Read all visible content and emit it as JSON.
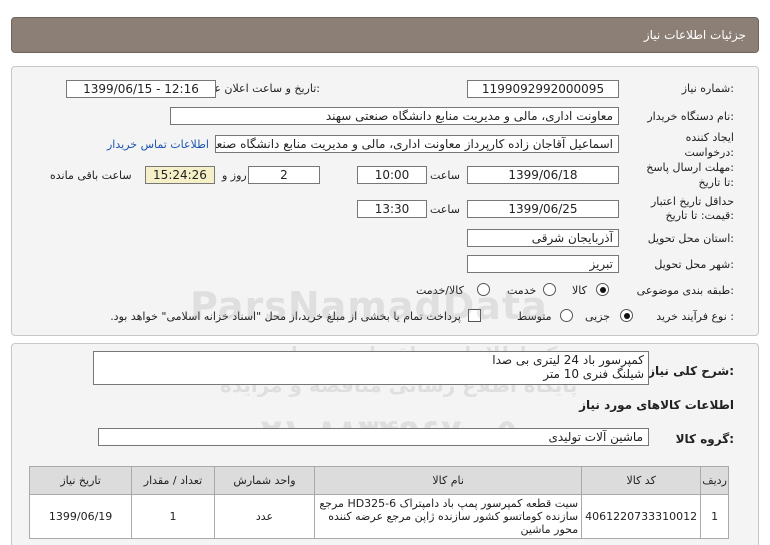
{
  "header": {
    "title": "جزئیات اطلاعات نیاز"
  },
  "form": {
    "need_number_label": "شماره نیاز:",
    "need_number": "1199092992000095",
    "announce_label": "تاریخ و ساعت اعلان عمومی:",
    "announce_value": "1399/06/15 - 12:16",
    "buyer_label": "نام دستگاه خریدار:",
    "buyer_value": "معاونت اداری، مالی و مدیریت منابع دانشگاه صنعتی سهند",
    "creator_label_1": "ایجاد کننده",
    "creator_label_2": "درخواست:",
    "creator_value": "اسماعیل آقاجان زاده کارپرداز معاونت اداری، مالی و مدیریت منابع دانشگاه صنعتی سهند",
    "contact_link": "اطلاعات تماس خریدار",
    "deadline_label_1": "مهلت ارسال پاسخ:",
    "deadline_label_2": "تا تاریخ:",
    "deadline_date": "1399/06/18",
    "time_label": "ساعت",
    "deadline_time": "10:00",
    "days_value": "2",
    "days_label": "روز و",
    "remaining_time": "15:24:26",
    "remaining_label": "ساعت باقی مانده",
    "validity_label_1": "حداقل تاریخ اعتبار",
    "validity_label_2": "قیمت: تا تاریخ:",
    "validity_date": "1399/06/25",
    "validity_time_label": "ساعت",
    "validity_time": "13:30",
    "province_label": "استان محل تحویل:",
    "province_value": "آذربایجان شرقی",
    "city_label": "شهر محل تحویل:",
    "city_value": "تبریز",
    "category_label": "طبقه بندی موضوعی:",
    "category_options": [
      "کالا",
      "خدمت",
      "کالا/خدمت"
    ],
    "category_selected": "کالا",
    "process_label": "نوع فرآیند خرید :",
    "process_options": [
      "جزیی",
      "متوسط"
    ],
    "process_selected": "جزیی",
    "payment_note": "پرداخت تمام یا بخشی از مبلغ خرید،از محل \"اسناد خزانه اسلامی\" خواهد بود."
  },
  "details": {
    "desc_label": "شرح کلی نیاز:",
    "desc_line_1": "کمپرسور باد 24 لیتری بی صدا",
    "desc_line_2": "شیلنگ فنری 10 متر",
    "goods_info_title": "اطلاعات کالاهای مورد نیاز",
    "group_label": "گروه کالا:",
    "group_value": "ماشین آلات تولیدی"
  },
  "table": {
    "headers": [
      "ردیف",
      "کد کالا",
      "نام کالا",
      "واحد شمارش",
      "تعداد / مقدار",
      "تاریخ نیاز"
    ],
    "rows": [
      {
        "row": "1",
        "code": "4061220733310012",
        "name": "سیت قطعه کمپرسور پمپ باد دامپتراک HD325-6 مرجع سازنده کوماتسو کشور سازنده ژاپن مرجع عرضه کننده محور ماشین",
        "unit": "عدد",
        "qty": "1",
        "date": "1399/06/19"
      }
    ]
  },
  "watermark": {
    "brand": "ParsNamadData",
    "line1": "مرکز اطلاعات مناقصات و مزایده",
    "line2": "پایگاه اطلاع رسانی مناقصه و مزایده",
    "phone": "۰۲۱-۸۸۳۴۹۶۷۰-۵"
  },
  "colors": {
    "header_bg": "#8b7f76",
    "link": "#1a55b0",
    "timer_bg": "#f5f0c8"
  }
}
